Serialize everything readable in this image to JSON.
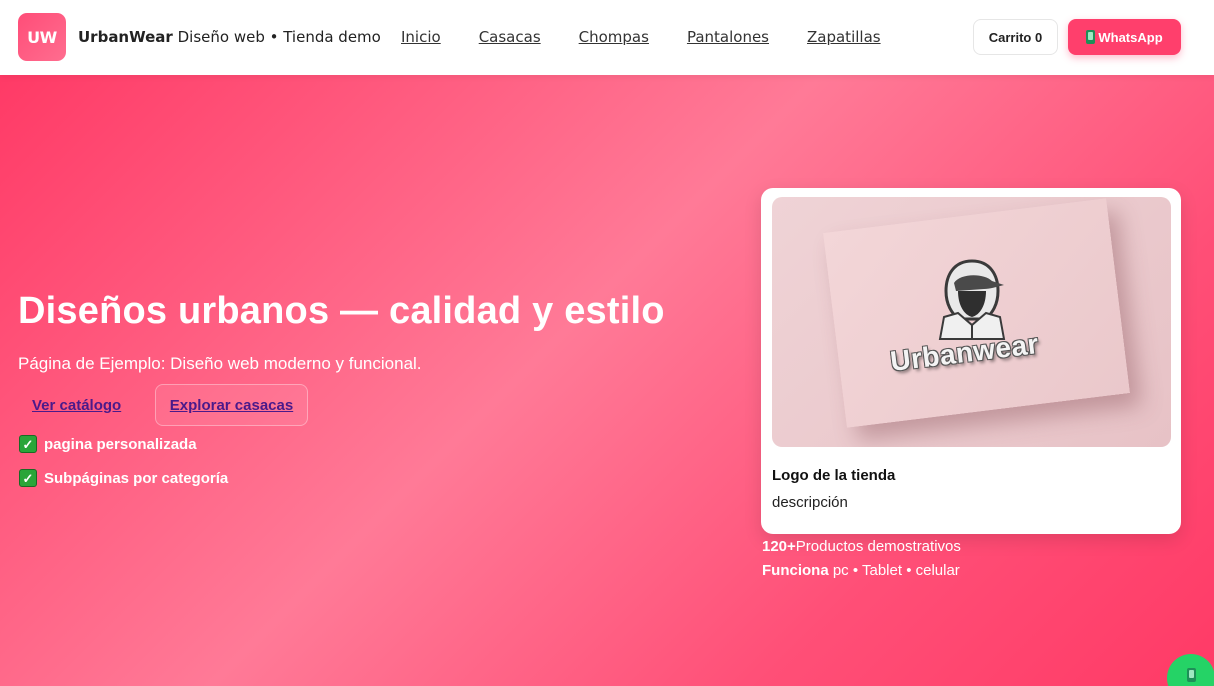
{
  "header": {
    "logo_badge": "UW",
    "brand_name": "UrbanWear",
    "brand_tagline": "Diseño web • Tienda demo",
    "nav": [
      "Inicio",
      "Casacas",
      "Chompas",
      "Pantalones",
      "Zapatillas"
    ],
    "cart_label": "Carrito",
    "cart_count": "0",
    "whatsapp_label": "WhatsApp"
  },
  "hero": {
    "title": "Diseños urbanos — calidad y estilo",
    "subtitle": "Página de Ejemplo: Diseño web moderno y funcional.",
    "primary_button": "Ver catálogo",
    "secondary_button": "Explorar casacas",
    "features": [
      "pagina personalizada",
      "Subpáginas por categoría"
    ]
  },
  "card": {
    "image_wordmark": "Urbanwear",
    "title": "Logo de la tienda",
    "description": "descripción"
  },
  "stats": {
    "products_value": "120+",
    "products_label": "Productos demostrativos",
    "devices_label": "Funciona",
    "devices_value": "pc • Tablet • celular"
  },
  "colors": {
    "accent": "#ff3f6c",
    "hero_start": "#ff3a66",
    "hero_mid": "#ff7a97",
    "whatsapp_green": "#25d366",
    "link_purple": "#4b1a8a"
  },
  "icons": {
    "whatsapp_button_icon": "mobile-phone-icon",
    "feature_icon": "check-mark-icon",
    "floating_icon": "mobile-phone-icon"
  }
}
